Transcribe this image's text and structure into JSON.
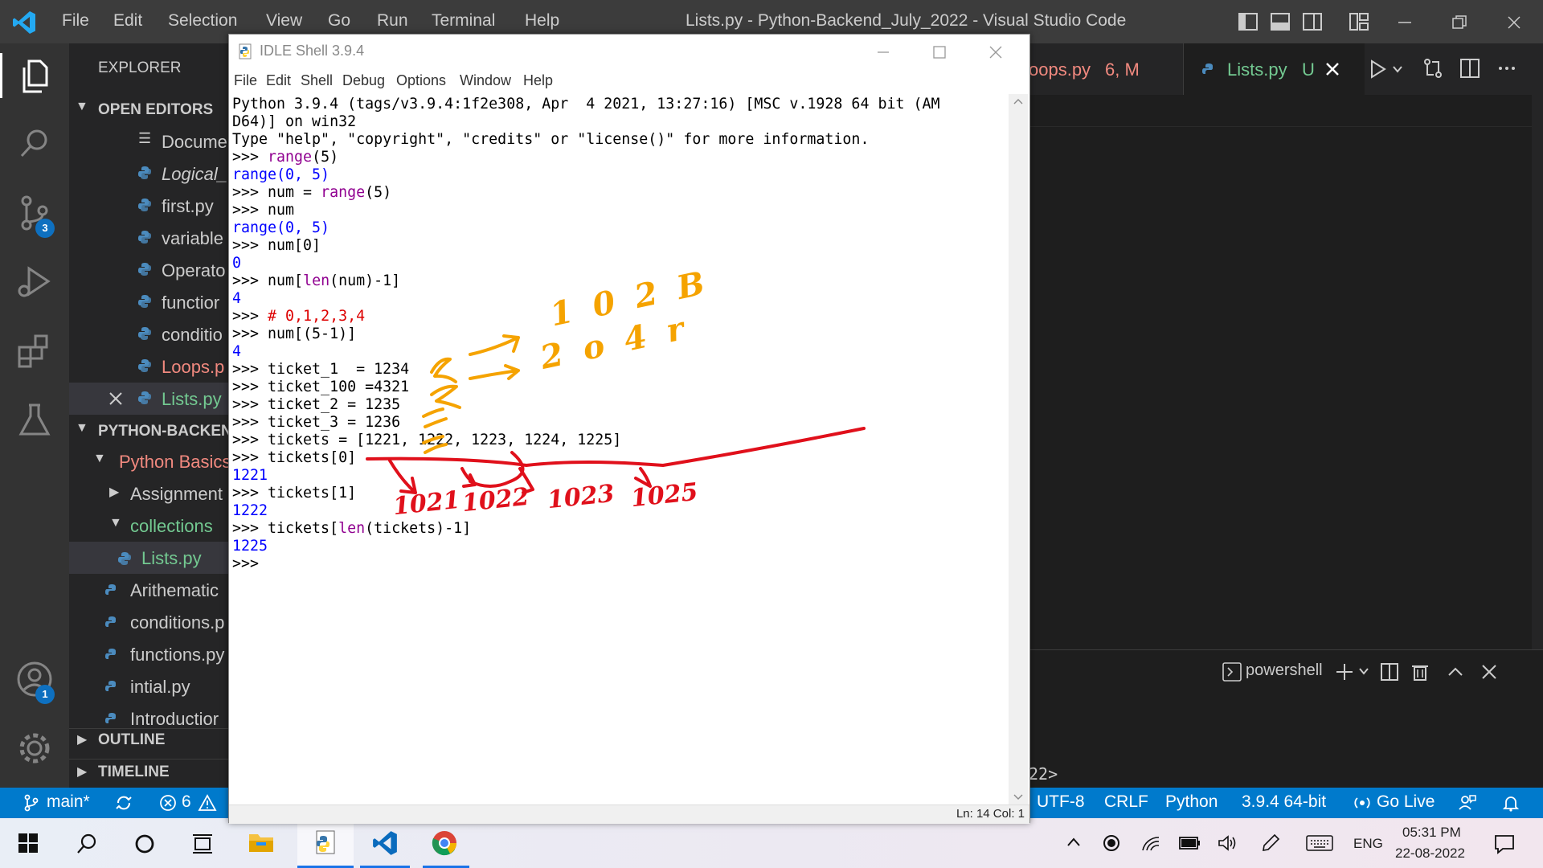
{
  "vscode": {
    "menu": [
      "File",
      "Edit",
      "Selection",
      "View",
      "Go",
      "Run",
      "Terminal",
      "Help"
    ],
    "title": "Lists.py - Python-Backend_July_2022 - Visual Studio Code",
    "activity": {
      "source_control_badge": "3",
      "accounts_badge": "1"
    },
    "sidebar": {
      "explorer_title": "EXPLORER",
      "open_editors_title": "OPEN EDITORS",
      "open_editors": [
        {
          "label": "Docume",
          "icon": "list-icon"
        },
        {
          "label": "Logical_",
          "icon": "python-icon"
        },
        {
          "label": "first.py",
          "icon": "python-icon"
        },
        {
          "label": "variable",
          "icon": "python-icon"
        },
        {
          "label": "Operato",
          "icon": "python-icon"
        },
        {
          "label": "functior",
          "icon": "python-icon"
        },
        {
          "label": "conditio",
          "icon": "python-icon"
        },
        {
          "label": "Loops.p",
          "icon": "python-icon"
        },
        {
          "label": "Lists.py",
          "icon": "python-icon"
        }
      ],
      "project_title": "PYTHON-BACKEN",
      "tree": [
        {
          "label": "Python Basics",
          "kind": "folder-open"
        },
        {
          "label": "Assignment",
          "kind": "folder-closed"
        },
        {
          "label": "collections",
          "kind": "folder-open"
        },
        {
          "label": "Lists.py",
          "kind": "file"
        },
        {
          "label": "Arithematic",
          "kind": "file"
        },
        {
          "label": "conditions.p",
          "kind": "file"
        },
        {
          "label": "functions.py",
          "kind": "file"
        },
        {
          "label": "intial.py",
          "kind": "file"
        },
        {
          "label": "Introductior",
          "kind": "file"
        }
      ],
      "outline_title": "OUTLINE",
      "timeline_title": "TIMELINE"
    },
    "tabs": [
      {
        "label": "oops.py",
        "extra": "6, M"
      },
      {
        "label": "Lists.py",
        "extra": "U"
      }
    ],
    "terminal": {
      "label": "powershell",
      "prompt_tail": "22>"
    },
    "status": {
      "branch": "main*",
      "errors": "6",
      "warnings": "",
      "encoding": "UTF-8",
      "eol": "CRLF",
      "language": "Python",
      "interpreter": "3.9.4 64-bit",
      "golive": "Go Live"
    }
  },
  "idle": {
    "title": "IDLE Shell 3.9.4",
    "menu": [
      "File",
      "Edit",
      "Shell",
      "Debug",
      "Options",
      "Window",
      "Help"
    ],
    "lines": [
      [
        [
          "Python 3.9.4 (tags/v3.9.4:1f2e308, Apr  4 2021, 13:27:16) [MSC v.1928 64 bit (AM",
          "black"
        ]
      ],
      [
        [
          "D64)] on win32",
          "black"
        ]
      ],
      [
        [
          "Type \"help\", \"copyright\", \"credits\" or \"license()\" for more information.",
          "black"
        ]
      ],
      [
        [
          ">>> ",
          "black"
        ],
        [
          "range",
          "purple"
        ],
        [
          "(5)",
          "black"
        ]
      ],
      [
        [
          "range(0, 5)",
          "blue"
        ]
      ],
      [
        [
          ">>> num = ",
          "black"
        ],
        [
          "range",
          "purple"
        ],
        [
          "(5)",
          "black"
        ]
      ],
      [
        [
          ">>> num",
          "black"
        ]
      ],
      [
        [
          "range(0, 5)",
          "blue"
        ]
      ],
      [
        [
          ">>> num[0]",
          "black"
        ]
      ],
      [
        [
          "0",
          "blue"
        ]
      ],
      [
        [
          ">>> num[",
          "black"
        ],
        [
          "len",
          "purple"
        ],
        [
          "(num)-1]",
          "black"
        ]
      ],
      [
        [
          "4",
          "blue"
        ]
      ],
      [
        [
          ">>> ",
          "black"
        ],
        [
          "# 0,1,2,3,4",
          "red"
        ]
      ],
      [
        [
          ">>> num[(5-1)]",
          "black"
        ]
      ],
      [
        [
          "4",
          "blue"
        ]
      ],
      [
        [
          ">>> ticket_1  = 1234",
          "black"
        ]
      ],
      [
        [
          ">>> ticket_100 =4321",
          "black"
        ]
      ],
      [
        [
          ">>> ticket_2 = 1235",
          "black"
        ]
      ],
      [
        [
          ">>> ticket_3 = 1236",
          "black"
        ]
      ],
      [
        [
          ">>> tickets = [1221, 1222, 1223, 1224, 1225]",
          "black"
        ]
      ],
      [
        [
          ">>> tickets[0]",
          "black"
        ]
      ],
      [
        [
          "1221",
          "blue"
        ]
      ],
      [
        [
          ">>> tickets[1]",
          "black"
        ]
      ],
      [
        [
          "1222",
          "blue"
        ]
      ],
      [
        [
          ">>> tickets[",
          "black"
        ],
        [
          "len",
          "purple"
        ],
        [
          "(tickets)-1]",
          "black"
        ]
      ],
      [
        [
          "1225",
          "blue"
        ]
      ],
      [
        [
          ">>> ",
          "black"
        ]
      ]
    ],
    "status": "Ln: 14   Col: 1"
  },
  "annotations": {
    "orange": [
      "1 0 2 B",
      "2 o 4 r"
    ],
    "red": [
      "1021",
      "1022",
      "1023",
      "1025"
    ]
  },
  "taskbar": {
    "lang": "ENG",
    "time": "05:31 PM",
    "date": "22-08-2022"
  }
}
